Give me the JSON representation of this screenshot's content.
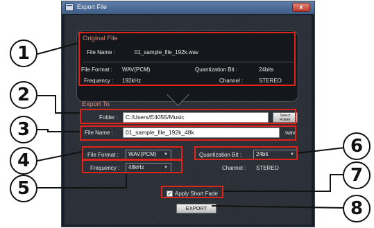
{
  "window": {
    "title": "Export File",
    "close_glyph": "x"
  },
  "original": {
    "section_title": "Original File",
    "file_name_label": "File Name :",
    "file_name_value": "01_sample_file_192k.wav",
    "file_format_label": "File Format :",
    "file_format_value": "WAV(PCM)",
    "frequency_label": "Frequency :",
    "frequency_value": "192kHz",
    "quant_label": "Quantization Bit :",
    "quant_value": "24bits",
    "channel_label": "Channel :",
    "channel_value": "STEREO"
  },
  "export": {
    "section_title": "Export To",
    "folder_label": "Folder :",
    "folder_value": "C:/Users/E4055/Music",
    "select_folder_line1": "Select",
    "select_folder_line2": "Folder",
    "file_name_label": "File Name :",
    "file_name_value": "01_sample_file_192k_48k",
    "extension": ".wav",
    "file_format_label": "File Format :",
    "file_format_value": "WAV(PCM)",
    "frequency_label": "Frequency :",
    "frequency_value": "48kHz",
    "quant_label": "Quantization Bit :",
    "quant_value": "24bit",
    "channel_label": "Channel :",
    "channel_value": "STEREO",
    "apply_short_fade_label": "Apply Short Fade",
    "apply_short_fade_checked": true,
    "check_glyph": "✓",
    "export_button": "EXPORT"
  },
  "dropdown_arrow_glyph": "▼",
  "callouts": [
    "1",
    "2",
    "3",
    "4",
    "5",
    "6",
    "7",
    "8"
  ],
  "colors": {
    "highlight": "#e2231a",
    "section_title": "#e1867b",
    "titlebar": "#3d5c88"
  }
}
